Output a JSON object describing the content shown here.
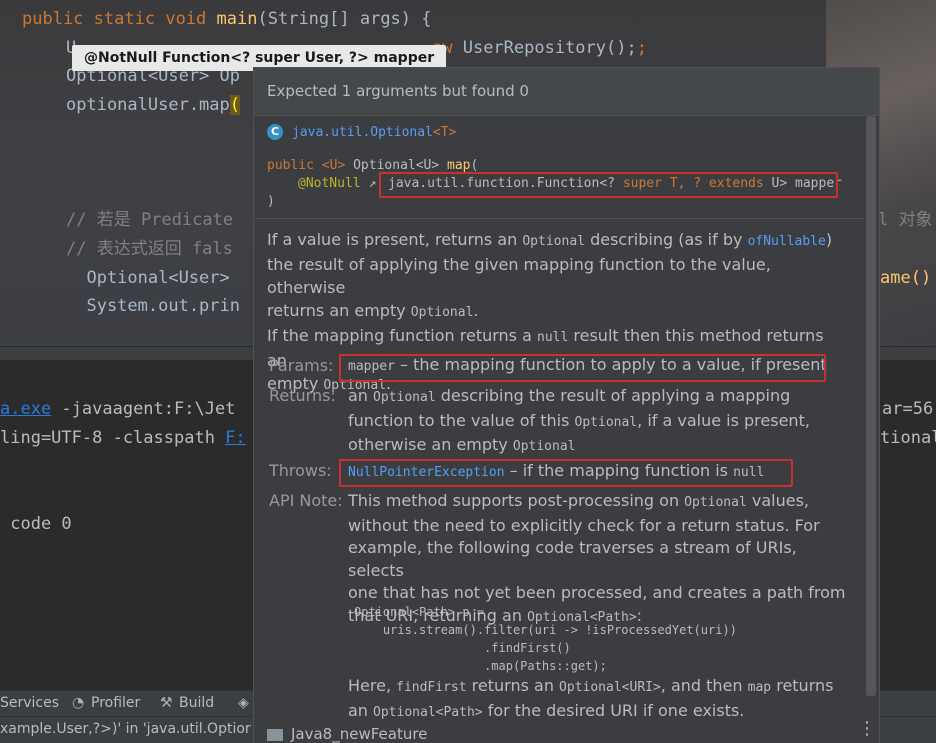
{
  "editor": {
    "line1": {
      "kw1": "public",
      "kw2": "static",
      "kw3": "void",
      "fn": "main",
      "rest": "(String[] args) {"
    },
    "line2": {
      "start": "U",
      "end_kw": "ew",
      "end": " UserRepository();"
    },
    "line3": "Optional<User> Op",
    "line4": {
      "text": "optionalUser.map",
      "paren": "("
    },
    "line5": "// 若是 Predicate",
    "line5_right": "l 对象",
    "line6": "// 表达式返回 fals",
    "line7": "  Optional<User>",
    "line7_right": "ame()",
    "line8": "  System.out.prin"
  },
  "param_hint": "@NotNull Function<? super User, ?> mapper",
  "console": {
    "line1": {
      "link": "a.exe",
      "text": " -javaagent:F:\\Jet",
      "right": "ar=56"
    },
    "line2": {
      "text": "ling=UTF-8 -classpath ",
      "link": "F:",
      "right": "tional"
    },
    "line3": " code 0"
  },
  "toolbar": {
    "services": "Services",
    "profiler": "Profiler",
    "build": "Build"
  },
  "statusbar": {
    "text": "xample.User,?>)' in 'java.util.Optior"
  },
  "doc": {
    "error": "Expected 1 arguments but found 0",
    "class_badge": "C",
    "class_name": "java.util.Optional",
    "class_type_param": "<T>",
    "sig_line1": {
      "kw": "public",
      "tp": "<U>",
      "ret": " Optional<U> ",
      "fn": "map",
      "paren": "("
    },
    "sig_line2": {
      "ann": "@NotNull",
      "arrow": "↗",
      "pre": "java.util.function.Function<? ",
      "super": "super",
      "t": " T, ? ",
      "extends": "extends",
      "u": " U> mapper"
    },
    "sig_line3": ")",
    "desc": {
      "p1a": "If a value is present, returns an ",
      "p1b": "Optional",
      "p1c": " describing (as if by ",
      "p1d": "ofNullable",
      "p1e": ")",
      "p2": "the result of applying the given mapping function to the value, otherwise",
      "p3a": "returns an empty ",
      "p3b": "Optional",
      "p3c": ".",
      "p4a": "If the mapping function returns a ",
      "p4b": "null",
      "p4c": " result then this method returns an",
      "p5a": "empty ",
      "p5b": "Optional",
      "p5c": "."
    },
    "params_label": "Params:",
    "params_code": "mapper",
    "params_text": " – the mapping function to apply to a value, if present",
    "returns_label": "Returns:",
    "returns_l1a": "an ",
    "returns_l1b": "Optional",
    "returns_l1c": " describing the result of applying a mapping",
    "returns_l2a": "function to the value of this ",
    "returns_l2b": "Optional",
    "returns_l2c": ", if a value is present,",
    "returns_l3a": "otherwise an empty ",
    "returns_l3b": "Optional",
    "throws_label": "Throws:",
    "throws_link": "NullPointerException",
    "throws_text": " – if the mapping function is ",
    "throws_code": "null",
    "api_label": "API Note:",
    "api_l1a": "This method supports post-processing on ",
    "api_l1b": "Optional",
    "api_l1c": " values,",
    "api_l2": "without the need to explicitly check for a return status. For",
    "api_l3": "example, the following code traverses a stream of URIs, selects",
    "api_l4": "one that has not yet been processed, and creates a path from",
    "api_l5a": "that URI, returning an ",
    "api_l5b": "Optional<Path>",
    "api_l5c": ":",
    "code1": "Optional<Path> p =",
    "code2": "    uris.stream().filter(uri -> !isProcessedYet(uri))",
    "code3": "                  .findFirst()",
    "code4": "                  .map(Paths::get);",
    "here_l1a": "Here, ",
    "here_l1b": "findFirst",
    "here_l1c": " returns an ",
    "here_l1d": "Optional<URI>",
    "here_l1e": ", and then ",
    "here_l1f": "map",
    "here_l1g": " returns",
    "here_l2a": "an ",
    "here_l2b": "Optional<Path>",
    "here_l2c": " for the desired URI if one exists.",
    "footer": "Java8_newFeature",
    "more": "⋮"
  },
  "colors": {
    "error_box": "#c93131",
    "keyword": "#cc7832",
    "link": "#589df6",
    "annotation": "#bbb529"
  }
}
